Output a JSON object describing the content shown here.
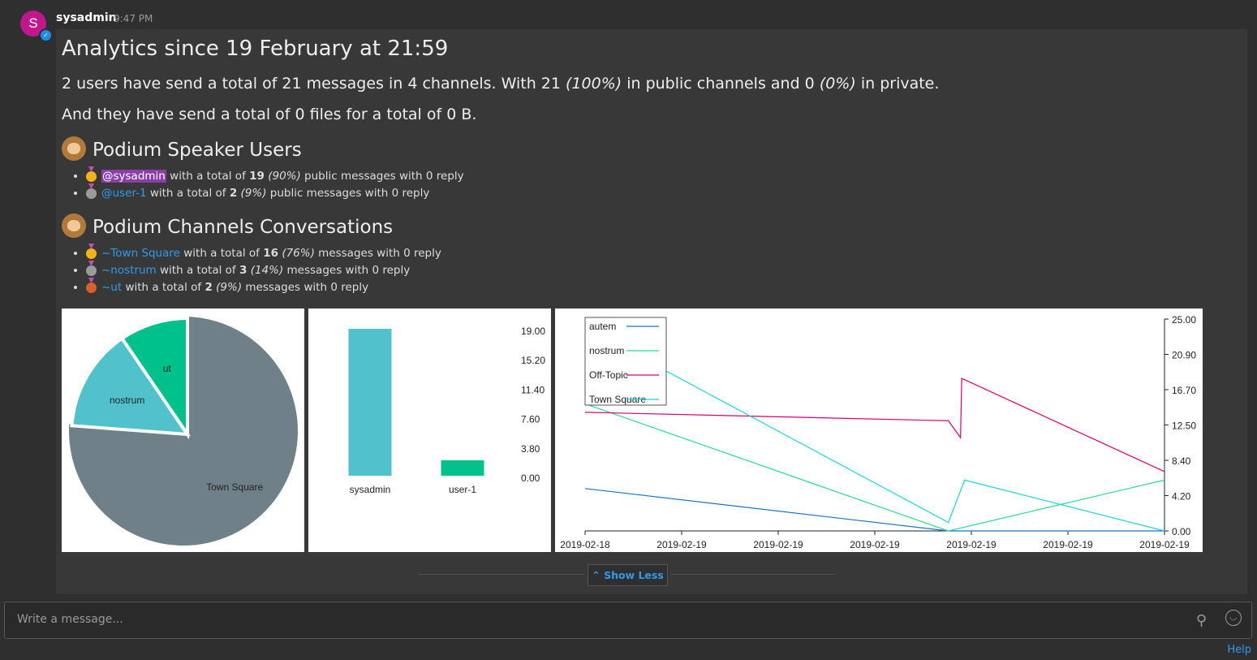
{
  "post": {
    "avatar_letter": "S",
    "author": "sysadmin",
    "time": "9:47 PM",
    "title": "Analytics since 19 February at 21:59",
    "summary1_a": "2 users have send a total of 21 messages in 4 channels. With 21 ",
    "summary1_b": "(100%)",
    "summary1_c": " in public channels and 0 ",
    "summary1_d": "(0%)",
    "summary1_e": " in private.",
    "summary2": "And they have send a total of 0 files for a total of 0 B.",
    "users_heading": "Podium Speaker Users",
    "users": [
      {
        "medal": "gold",
        "name": "@sysadmin",
        "pre": " with a total of ",
        "count": "19",
        "pct": "(90%)",
        "post": " public messages with 0 reply",
        "highlight": true
      },
      {
        "medal": "silver",
        "name": "@user-1",
        "pre": " with a total of ",
        "count": "2",
        "pct": "(9%)",
        "post": " public messages with 0 reply",
        "highlight": false
      }
    ],
    "channels_heading": "Podium Channels Conversations",
    "channels": [
      {
        "medal": "gold",
        "name": "~Town Square",
        "pre": " with a total of ",
        "count": "16",
        "pct": "(76%)",
        "post": " messages with 0 reply"
      },
      {
        "medal": "silver",
        "name": "~nostrum",
        "pre": " with a total of ",
        "count": "3",
        "pct": "(14%)",
        "post": " messages with 0 reply"
      },
      {
        "medal": "bronze",
        "name": "~ut",
        "pre": " with a total of ",
        "count": "2",
        "pct": "(9%)",
        "post": " messages with 0 reply"
      }
    ],
    "show_less": "Show Less"
  },
  "composer": {
    "placeholder": "Write a message...",
    "help": "Help"
  },
  "colors": {
    "accent": "#2f9bf0",
    "pie_gray": "#6f8088",
    "teal": "#51c2cb",
    "green": "#00c08b",
    "pink": "#d6006e",
    "blue": "#1a73c9",
    "cyan": "#1fd3d3",
    "mint": "#2ad98a"
  },
  "chart_data": [
    {
      "type": "pie",
      "slices": [
        {
          "label": "Town Square",
          "value": 16,
          "color": "#6f8088"
        },
        {
          "label": "nostrum",
          "value": 3,
          "color": "#51c2cb"
        },
        {
          "label": "ut",
          "value": 2,
          "color": "#00c08b"
        }
      ]
    },
    {
      "type": "bar",
      "categories": [
        "sysadmin",
        "user-1"
      ],
      "values": [
        19,
        2
      ],
      "colors": [
        "#51c2cb",
        "#00c08b"
      ],
      "yticks": [
        "19.00",
        "15.20",
        "11.40",
        "7.60",
        "3.80",
        "0.00"
      ],
      "ylim": [
        0,
        19
      ]
    },
    {
      "type": "line",
      "x": [
        "2019-02-18",
        "2019-02-19",
        "2019-02-19",
        "2019-02-19",
        "2019-02-19",
        "2019-02-19",
        "2019-02-19"
      ],
      "yticks": [
        "25.00",
        "20.90",
        "16.70",
        "12.50",
        "8.40",
        "4.20",
        "0.00"
      ],
      "ylim": [
        0,
        25
      ],
      "legend_position": "top-left",
      "series": [
        {
          "name": "autem",
          "color": "#1a73c9",
          "points": [
            [
              0,
              5
            ],
            [
              0.627,
              0
            ],
            [
              1,
              0
            ]
          ]
        },
        {
          "name": "nostrum",
          "color": "#2ad98a",
          "points": [
            [
              0,
              15
            ],
            [
              0.627,
              0
            ],
            [
              1,
              6
            ]
          ]
        },
        {
          "name": "Off-Topic",
          "color": "#d6006e",
          "points": [
            [
              0,
              14
            ],
            [
              0.627,
              13
            ],
            [
              0.648,
              11
            ],
            [
              0.65,
              18
            ],
            [
              1,
              7
            ]
          ]
        },
        {
          "name": "Town Square",
          "color": "#1fd3d3",
          "points": [
            [
              0,
              24
            ],
            [
              0.627,
              1
            ],
            [
              0.655,
              6
            ],
            [
              1,
              0
            ]
          ]
        }
      ]
    }
  ]
}
